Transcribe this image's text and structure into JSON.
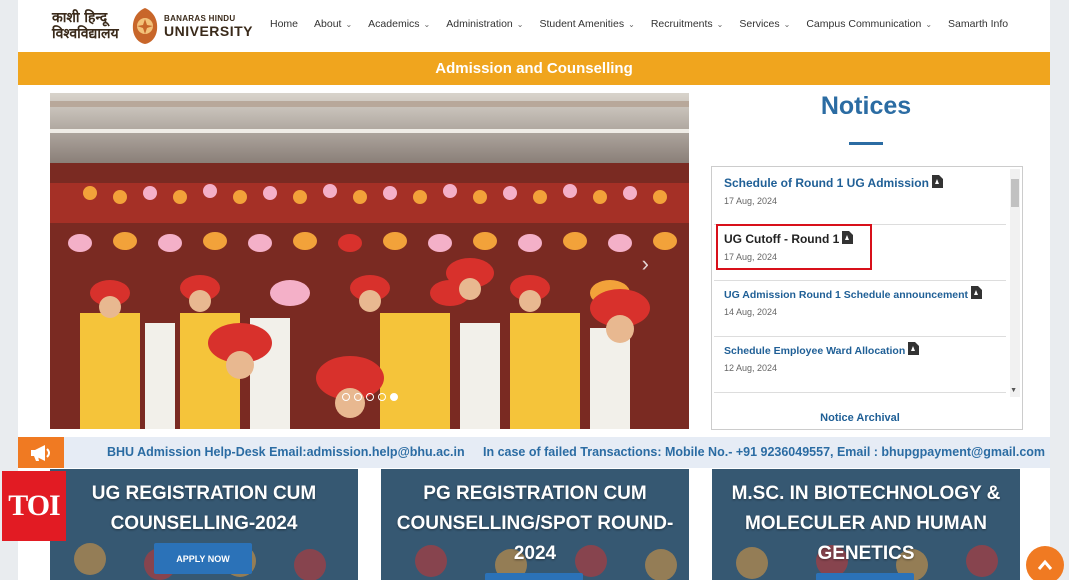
{
  "header": {
    "logo_hindi_line1": "काशी हिन्दू",
    "logo_hindi_line2": "विश्वविद्यालय",
    "logo_en_line1": "BANARAS HINDU",
    "logo_en_line2": "UNIVERSITY",
    "nav": [
      {
        "label": "Home",
        "has_dropdown": false
      },
      {
        "label": "About",
        "has_dropdown": true
      },
      {
        "label": "Academics",
        "has_dropdown": true
      },
      {
        "label": "Administration",
        "has_dropdown": true
      },
      {
        "label": "Student Amenities",
        "has_dropdown": true
      },
      {
        "label": "Recruitments",
        "has_dropdown": true
      },
      {
        "label": "Services",
        "has_dropdown": true
      },
      {
        "label": "Campus Communication",
        "has_dropdown": true
      },
      {
        "label": "Samarth Info",
        "has_dropdown": false
      }
    ]
  },
  "banner": {
    "title": "Admission and Counselling"
  },
  "carousel": {
    "slide_count": 5,
    "active_slide": 5,
    "next_icon": "chevron-right-icon"
  },
  "notices": {
    "title": "Notices",
    "items": [
      {
        "title": "Schedule of Round 1 UG Admission",
        "date": "17 Aug, 2024"
      },
      {
        "title": "UG Cutoff - Round 1",
        "date": "17 Aug, 2024"
      },
      {
        "title": "UG Admission Round 1 Schedule announcement",
        "date": "14 Aug, 2024"
      },
      {
        "title": "Schedule Employee Ward Allocation",
        "date": "12 Aug, 2024"
      }
    ],
    "archival_label": "Notice Archival"
  },
  "ticker": {
    "helpdesk": "BHU Admission Help-Desk Email:admission.help@bhu.ac.in",
    "payment": "In case of failed Transactions: Mobile No.- +91 9236049557, Email : bhupgpayment@gmail.com"
  },
  "cards": [
    {
      "title_line1": "UG REGISTRATION CUM",
      "title_line2": "COUNSELLING-2024",
      "title_line3": "",
      "button": "APPLY NOW"
    },
    {
      "title_line1": "PG REGISTRATION CUM",
      "title_line2": "COUNSELLING/SPOT ROUND-",
      "title_line3": "2024",
      "button": ""
    },
    {
      "title_line1": "M.SC. IN BIOTECHNOLOGY &",
      "title_line2": "MOLECULER AND HUMAN",
      "title_line3": "GENETICS",
      "button": ""
    }
  ],
  "watermark": "TOI",
  "colors": {
    "accent_orange": "#f0a51e",
    "link_blue": "#1f5f96",
    "highlight_red": "#d8101a",
    "button_blue": "#2b72b8"
  }
}
